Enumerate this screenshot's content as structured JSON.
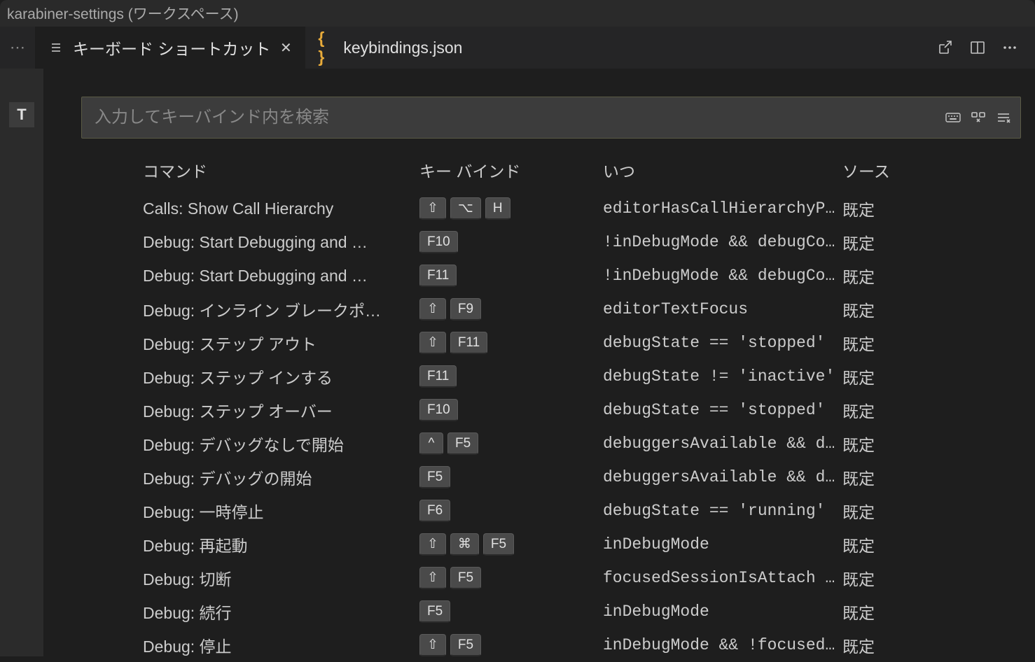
{
  "window": {
    "title": "karabiner-settings (ワークスペース)"
  },
  "tabs": {
    "overflow": "⋯",
    "items": [
      {
        "label": "キーボード ショートカット",
        "icon": "list",
        "active": true,
        "closable": true
      },
      {
        "label": "keybindings.json",
        "icon": "braces",
        "active": false,
        "closable": false
      }
    ]
  },
  "search": {
    "placeholder": "入力してキーバインド内を検索"
  },
  "gutter": {
    "marker": "T"
  },
  "columns": {
    "command": "コマンド",
    "keybinding": "キー バインド",
    "when": "いつ",
    "source": "ソース"
  },
  "rows": [
    {
      "command": "Calls: Show Call Hierarchy",
      "keys": [
        "⇧",
        "⌥",
        "H"
      ],
      "when": "editorHasCallHierarchyP…",
      "source": "既定"
    },
    {
      "command": "Debug: Start Debugging and …",
      "keys": [
        "F10"
      ],
      "when": "!inDebugMode && debugCo…",
      "source": "既定"
    },
    {
      "command": "Debug: Start Debugging and …",
      "keys": [
        "F11"
      ],
      "when": "!inDebugMode && debugCo…",
      "source": "既定"
    },
    {
      "command": "Debug: インライン ブレークポ…",
      "keys": [
        "⇧",
        "F9"
      ],
      "when": "editorTextFocus",
      "source": "既定"
    },
    {
      "command": "Debug: ステップ アウト",
      "keys": [
        "⇧",
        "F11"
      ],
      "when": "debugState == 'stopped'",
      "source": "既定"
    },
    {
      "command": "Debug: ステップ インする",
      "keys": [
        "F11"
      ],
      "when": "debugState != 'inactive'",
      "source": "既定"
    },
    {
      "command": "Debug: ステップ オーバー",
      "keys": [
        "F10"
      ],
      "when": "debugState == 'stopped'",
      "source": "既定"
    },
    {
      "command": "Debug: デバッグなしで開始",
      "keys": [
        "^",
        "F5"
      ],
      "when": "debuggersAvailable && d…",
      "source": "既定"
    },
    {
      "command": "Debug: デバッグの開始",
      "keys": [
        "F5"
      ],
      "when": "debuggersAvailable && d…",
      "source": "既定"
    },
    {
      "command": "Debug: 一時停止",
      "keys": [
        "F6"
      ],
      "when": "debugState == 'running'",
      "source": "既定"
    },
    {
      "command": "Debug: 再起動",
      "keys": [
        "⇧",
        "⌘",
        "F5"
      ],
      "when": "inDebugMode",
      "source": "既定"
    },
    {
      "command": "Debug: 切断",
      "keys": [
        "⇧",
        "F5"
      ],
      "when": "focusedSessionIsAttach …",
      "source": "既定"
    },
    {
      "command": "Debug: 続行",
      "keys": [
        "F5"
      ],
      "when": "inDebugMode",
      "source": "既定"
    },
    {
      "command": "Debug: 停止",
      "keys": [
        "⇧",
        "F5"
      ],
      "when": "inDebugMode && !focused…",
      "source": "既定"
    }
  ]
}
